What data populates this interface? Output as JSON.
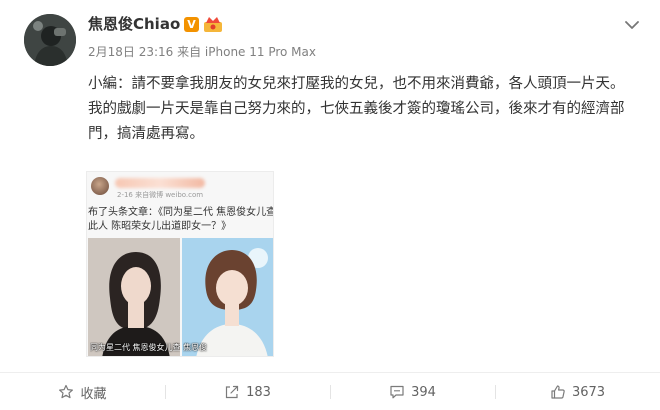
{
  "post": {
    "username": "焦恩俊Chiao",
    "verified_badge": "V",
    "meta": "2月18日 23:16 来自 iPhone 11 Pro Max",
    "paragraphs": [
      "小編：請不要拿我朋友的女兒來打壓我的女兒，也不用來消費爺，各人頭頂一片天。",
      "我的戲劇一片天是靠自己努力來的，七俠五義後才簽的瓊瑤公司，後來才有的經濟部門，搞清處再寫。"
    ]
  },
  "shared_card": {
    "sub": "2-16 来自微博 weibo.com",
    "title_line1": "布了头条文章：《同为星二代 焦恩俊女儿查",
    "title_line2": "此人 陈昭荣女儿出道即女一？》",
    "caption_left": "同为星二代 焦恩俊女儿查无此人 陈昭荣女儿出道即女一？",
    "caption_right": "焦恩俊"
  },
  "actions": {
    "favorite": "收藏",
    "repost": "183",
    "comment": "394",
    "like": "3673"
  },
  "colors": {
    "verified_orange": "#f39200",
    "text": "#333333",
    "meta": "#808080"
  },
  "icons": {
    "chevron": "chevron-down-icon",
    "favorite": "star-icon",
    "repost": "share-arrow-icon",
    "comment": "comment-icon",
    "like": "thumbs-up-icon"
  }
}
